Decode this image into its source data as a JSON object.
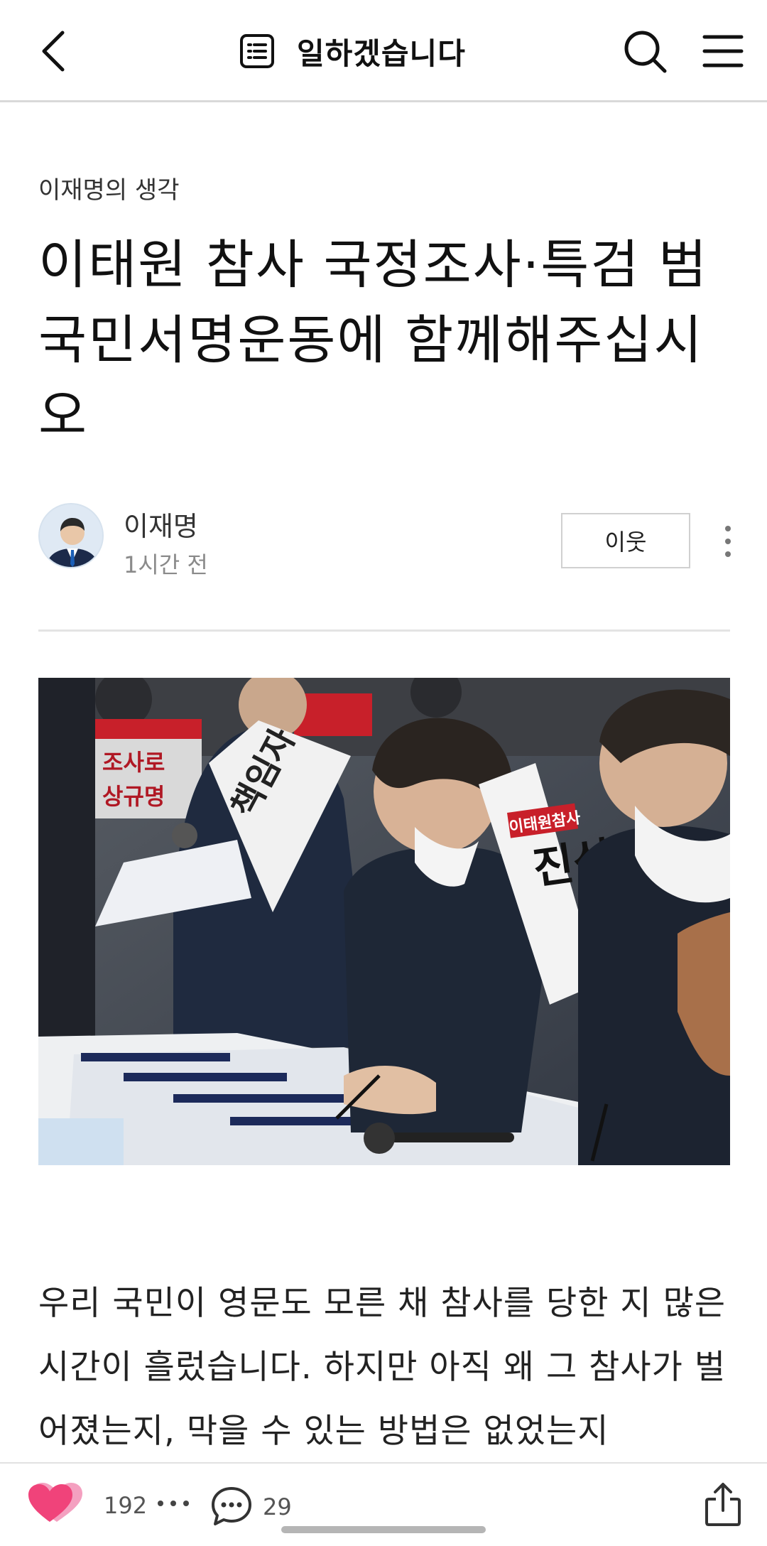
{
  "header": {
    "blog_title": "일하겠습니다",
    "back_icon": "chevron-left-icon",
    "list_icon": "list-icon",
    "search_icon": "search-icon",
    "menu_icon": "hamburger-menu-icon"
  },
  "post": {
    "category": "이재명의 생각",
    "title": "이태원 참사 국정조사·특검 범국민서명운동에 함께해주십시오",
    "author": "이재명",
    "time": "1시간 전",
    "neighbor_label": "이웃",
    "photo_sash_texts": [
      "책임자",
      "진상",
      "이태원참사"
    ],
    "photo_sign_texts": [
      "조사로",
      "상규명"
    ],
    "body": "우리 국민이 영문도 모른 채 참사를 당한 지 많은 시간이 흘렀습니다. 하지만 아직 왜 그 참사가 벌어졌는지, 막을 수 있는 방법은 없었는지"
  },
  "bottom": {
    "like_count": "192",
    "comment_count": "29",
    "like_icon": "heart-icon",
    "comment_icon": "speech-bubble-icon",
    "share_icon": "share-icon"
  },
  "colors": {
    "accent_like": "#f0437a",
    "text": "#111111",
    "muted": "#8a8a8a"
  }
}
